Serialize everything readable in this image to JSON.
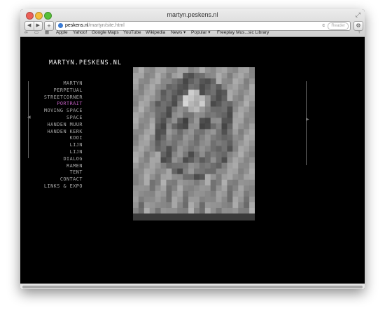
{
  "window": {
    "title": "martyn.peskens.nl",
    "fullscreen_icon": "fullscreen-icon"
  },
  "toolbar": {
    "back": "◀",
    "forward": "▶",
    "new_tab": "+",
    "url_domain": "peskens.nl",
    "url_path": "/martyn/site.html",
    "reload": "c",
    "reader": "Reader",
    "settings_icon": "⚙"
  },
  "bookmarks": {
    "items": [
      "Apple",
      "Yahoo!",
      "Google Maps",
      "YouTube",
      "Wikipedia",
      "News ▾",
      "Popular ▾",
      "Freeplay Mus...sic Library"
    ],
    "reading_list_icon": "glasses-icon",
    "bookmarks_icon": "book-icon",
    "top_sites_icon": "grid-icon",
    "add_icon": "+"
  },
  "site": {
    "title": "MARTYN.PESKENS.NL",
    "menu": [
      {
        "label": "MARTYN",
        "active": false
      },
      {
        "label": "PERPETUAL",
        "active": false
      },
      {
        "label": "STREETCORNER",
        "active": false
      },
      {
        "label": "PORTRAIT",
        "active": true
      },
      {
        "label": "MOVING SPACE",
        "active": false
      },
      {
        "label": "SPACE",
        "active": false
      },
      {
        "label": "HANDEN MUUR",
        "active": false
      },
      {
        "label": "HANDEN KERK",
        "active": false
      },
      {
        "label": "KOOI",
        "active": false
      },
      {
        "label": "LIJN",
        "active": false
      },
      {
        "label": "LIJN",
        "active": false
      },
      {
        "label": "DIALOG",
        "active": false
      },
      {
        "label": "RAMEN",
        "active": false
      },
      {
        "label": "TENT",
        "active": false
      },
      {
        "label": "CONTACT",
        "active": false
      },
      {
        "label": "LINKS & EXPO",
        "active": false
      }
    ],
    "active_color": "#c25fc2",
    "menu_color": "#aaaaaa",
    "prev_arrow": "◀",
    "next_arrow": "▶",
    "artwork_icon": "pixelated-portrait-image"
  }
}
